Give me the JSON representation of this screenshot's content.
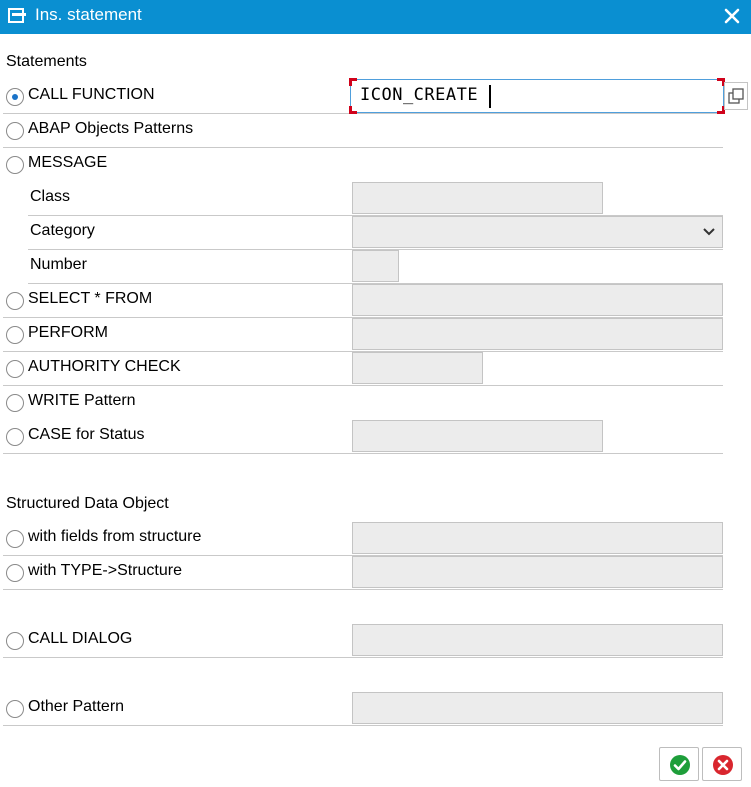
{
  "window": {
    "title": "Ins. statement",
    "close_icon": "close-icon",
    "title_icon": "statement-icon"
  },
  "statements": {
    "heading": "Statements",
    "call_function": {
      "label": "CALL FUNCTION",
      "selected": true,
      "value": "ICON_CREATE"
    },
    "abap_objects": {
      "label": "ABAP Objects Patterns",
      "selected": false
    },
    "message": {
      "label": "MESSAGE",
      "selected": false,
      "class_label": "Class",
      "class_value": "",
      "category_label": "Category",
      "category_value": "",
      "number_label": "Number",
      "number_value": ""
    },
    "select_from": {
      "label": "SELECT * FROM",
      "selected": false,
      "value": ""
    },
    "perform": {
      "label": "PERFORM",
      "selected": false,
      "value": ""
    },
    "authority_check": {
      "label": "AUTHORITY CHECK",
      "selected": false,
      "value": ""
    },
    "write_pattern": {
      "label": "WRITE Pattern",
      "selected": false
    },
    "case_status": {
      "label": "CASE for Status",
      "selected": false,
      "value": ""
    }
  },
  "structured": {
    "heading": "Structured Data Object",
    "with_fields": {
      "label": "with fields from structure",
      "selected": false,
      "value": ""
    },
    "with_type": {
      "label": "with TYPE->Structure",
      "selected": false,
      "value": ""
    }
  },
  "call_dialog": {
    "label": "CALL DIALOG",
    "selected": false,
    "value": ""
  },
  "other_pattern": {
    "label": "Other Pattern",
    "selected": false,
    "value": ""
  },
  "buttons": {
    "ok_icon": "checkmark-icon",
    "cancel_icon": "cancel-icon"
  },
  "colors": {
    "title_bar": "#0a8fd1",
    "ok_green": "#1e9e3a",
    "cancel_red": "#d9262e",
    "focus_corner": "#d0021b"
  }
}
